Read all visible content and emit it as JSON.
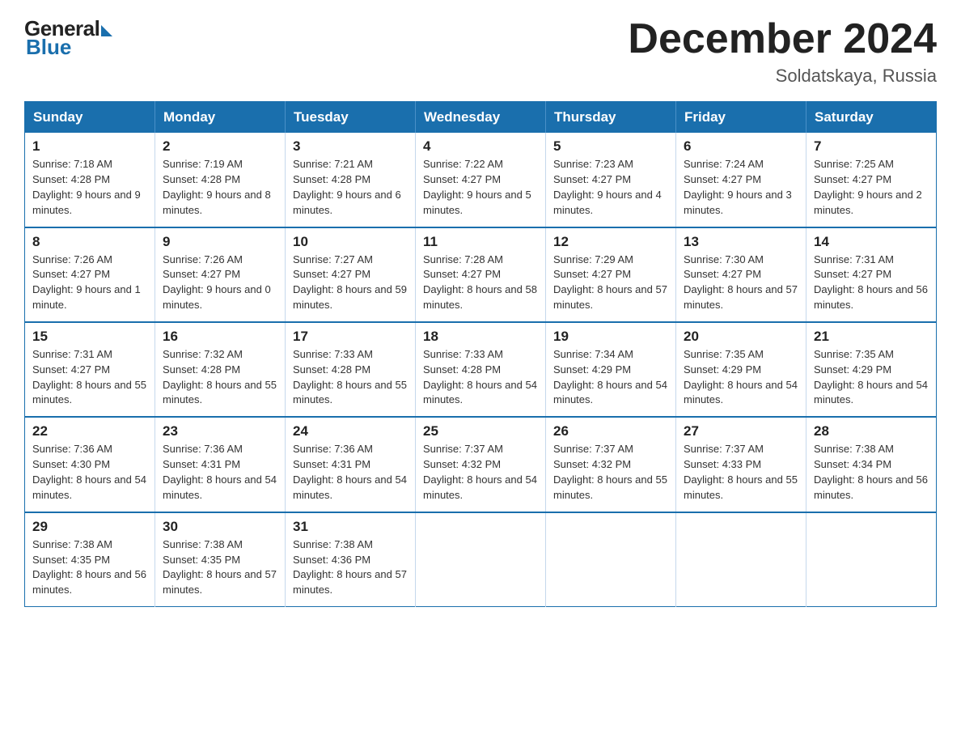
{
  "logo": {
    "general": "General",
    "blue": "Blue"
  },
  "header": {
    "month": "December 2024",
    "location": "Soldatskaya, Russia"
  },
  "weekdays": [
    "Sunday",
    "Monday",
    "Tuesday",
    "Wednesday",
    "Thursday",
    "Friday",
    "Saturday"
  ],
  "weeks": [
    [
      {
        "day": "1",
        "sunrise": "7:18 AM",
        "sunset": "4:28 PM",
        "daylight": "9 hours and 9 minutes."
      },
      {
        "day": "2",
        "sunrise": "7:19 AM",
        "sunset": "4:28 PM",
        "daylight": "9 hours and 8 minutes."
      },
      {
        "day": "3",
        "sunrise": "7:21 AM",
        "sunset": "4:28 PM",
        "daylight": "9 hours and 6 minutes."
      },
      {
        "day": "4",
        "sunrise": "7:22 AM",
        "sunset": "4:27 PM",
        "daylight": "9 hours and 5 minutes."
      },
      {
        "day": "5",
        "sunrise": "7:23 AM",
        "sunset": "4:27 PM",
        "daylight": "9 hours and 4 minutes."
      },
      {
        "day": "6",
        "sunrise": "7:24 AM",
        "sunset": "4:27 PM",
        "daylight": "9 hours and 3 minutes."
      },
      {
        "day": "7",
        "sunrise": "7:25 AM",
        "sunset": "4:27 PM",
        "daylight": "9 hours and 2 minutes."
      }
    ],
    [
      {
        "day": "8",
        "sunrise": "7:26 AM",
        "sunset": "4:27 PM",
        "daylight": "9 hours and 1 minute."
      },
      {
        "day": "9",
        "sunrise": "7:26 AM",
        "sunset": "4:27 PM",
        "daylight": "9 hours and 0 minutes."
      },
      {
        "day": "10",
        "sunrise": "7:27 AM",
        "sunset": "4:27 PM",
        "daylight": "8 hours and 59 minutes."
      },
      {
        "day": "11",
        "sunrise": "7:28 AM",
        "sunset": "4:27 PM",
        "daylight": "8 hours and 58 minutes."
      },
      {
        "day": "12",
        "sunrise": "7:29 AM",
        "sunset": "4:27 PM",
        "daylight": "8 hours and 57 minutes."
      },
      {
        "day": "13",
        "sunrise": "7:30 AM",
        "sunset": "4:27 PM",
        "daylight": "8 hours and 57 minutes."
      },
      {
        "day": "14",
        "sunrise": "7:31 AM",
        "sunset": "4:27 PM",
        "daylight": "8 hours and 56 minutes."
      }
    ],
    [
      {
        "day": "15",
        "sunrise": "7:31 AM",
        "sunset": "4:27 PM",
        "daylight": "8 hours and 55 minutes."
      },
      {
        "day": "16",
        "sunrise": "7:32 AM",
        "sunset": "4:28 PM",
        "daylight": "8 hours and 55 minutes."
      },
      {
        "day": "17",
        "sunrise": "7:33 AM",
        "sunset": "4:28 PM",
        "daylight": "8 hours and 55 minutes."
      },
      {
        "day": "18",
        "sunrise": "7:33 AM",
        "sunset": "4:28 PM",
        "daylight": "8 hours and 54 minutes."
      },
      {
        "day": "19",
        "sunrise": "7:34 AM",
        "sunset": "4:29 PM",
        "daylight": "8 hours and 54 minutes."
      },
      {
        "day": "20",
        "sunrise": "7:35 AM",
        "sunset": "4:29 PM",
        "daylight": "8 hours and 54 minutes."
      },
      {
        "day": "21",
        "sunrise": "7:35 AM",
        "sunset": "4:29 PM",
        "daylight": "8 hours and 54 minutes."
      }
    ],
    [
      {
        "day": "22",
        "sunrise": "7:36 AM",
        "sunset": "4:30 PM",
        "daylight": "8 hours and 54 minutes."
      },
      {
        "day": "23",
        "sunrise": "7:36 AM",
        "sunset": "4:31 PM",
        "daylight": "8 hours and 54 minutes."
      },
      {
        "day": "24",
        "sunrise": "7:36 AM",
        "sunset": "4:31 PM",
        "daylight": "8 hours and 54 minutes."
      },
      {
        "day": "25",
        "sunrise": "7:37 AM",
        "sunset": "4:32 PM",
        "daylight": "8 hours and 54 minutes."
      },
      {
        "day": "26",
        "sunrise": "7:37 AM",
        "sunset": "4:32 PM",
        "daylight": "8 hours and 55 minutes."
      },
      {
        "day": "27",
        "sunrise": "7:37 AM",
        "sunset": "4:33 PM",
        "daylight": "8 hours and 55 minutes."
      },
      {
        "day": "28",
        "sunrise": "7:38 AM",
        "sunset": "4:34 PM",
        "daylight": "8 hours and 56 minutes."
      }
    ],
    [
      {
        "day": "29",
        "sunrise": "7:38 AM",
        "sunset": "4:35 PM",
        "daylight": "8 hours and 56 minutes."
      },
      {
        "day": "30",
        "sunrise": "7:38 AM",
        "sunset": "4:35 PM",
        "daylight": "8 hours and 57 minutes."
      },
      {
        "day": "31",
        "sunrise": "7:38 AM",
        "sunset": "4:36 PM",
        "daylight": "8 hours and 57 minutes."
      },
      null,
      null,
      null,
      null
    ]
  ]
}
